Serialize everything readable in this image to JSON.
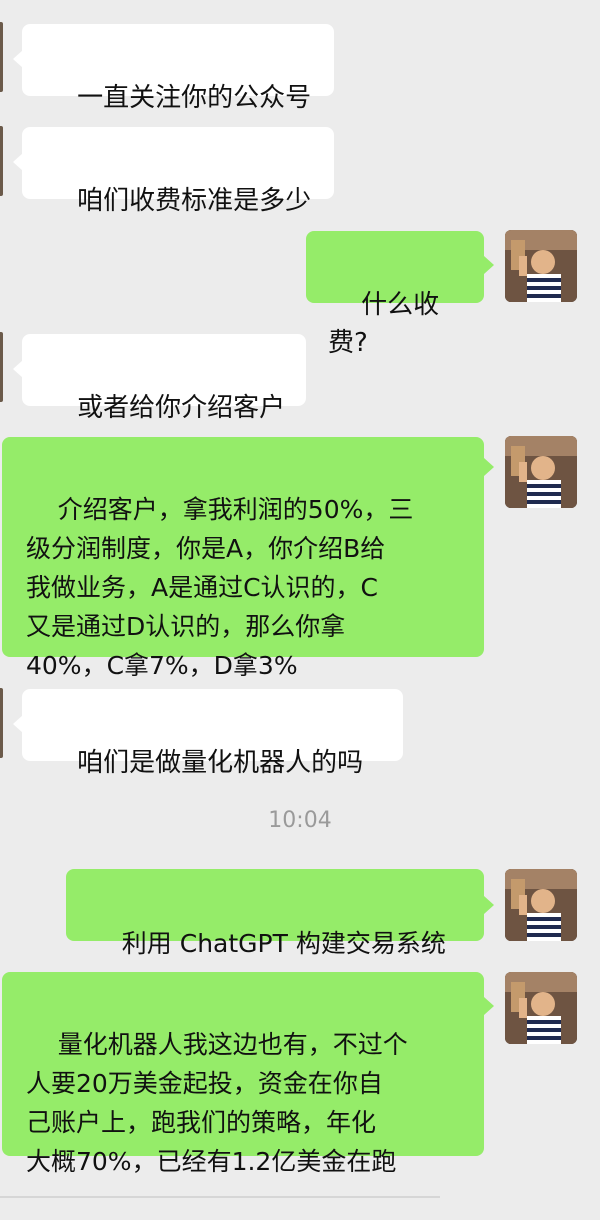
{
  "messages": [
    {
      "text": "一直关注你的公众号"
    },
    {
      "text": "咱们收费标准是多少"
    },
    {
      "text": "什么收费?"
    },
    {
      "text": "或者给你介绍客户"
    },
    {
      "text": "介绍客户，拿我利润的50%，三\n级分润制度，你是A，你介绍B给\n我做业务，A是通过C认识的，C\n又是通过D认识的，那么你拿\n40%，C拿7%，D拿3%"
    },
    {
      "text": "咱们是做量化机器人的吗"
    },
    {
      "text": "利用 ChatGPT 构建交易系统"
    },
    {
      "text": "量化机器人我这边也有，不过个\n人要20万美金起投，资金在你自\n己账户上，跑我们的策略，年化\n大概70%，已经有1.2亿美金在跑"
    }
  ],
  "timestamp": "10:04",
  "colors": {
    "background": "#ececec",
    "incoming_bubble": "#ffffff",
    "outgoing_bubble": "#95ec69",
    "timestamp_text": "#9a9a9a"
  },
  "icons": {
    "avatar": "user-avatar-photo"
  }
}
